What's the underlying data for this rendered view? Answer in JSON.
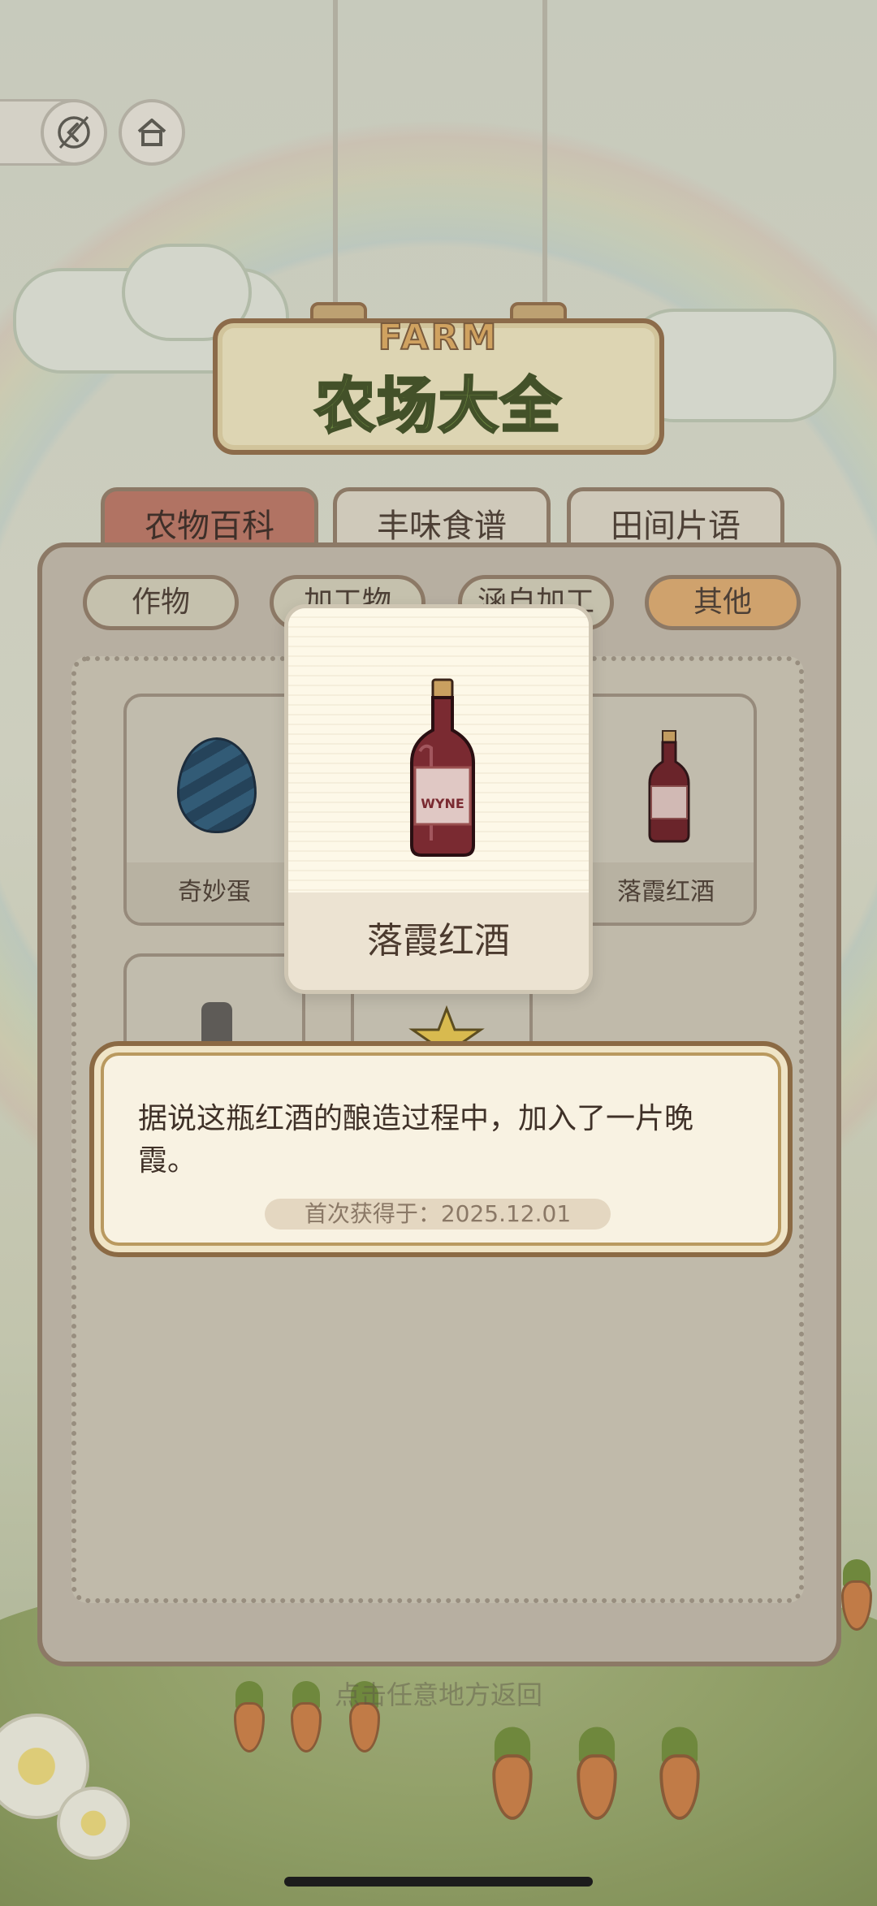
{
  "header": {
    "logo_farm_text": "FARM",
    "logo_title": "农场大全",
    "back_icon": "back-arrow-icon",
    "home_icon": "home-icon"
  },
  "category_tabs": [
    {
      "label": "农物百科",
      "active": true
    },
    {
      "label": "丰味食谱",
      "active": false
    },
    {
      "label": "田间片语",
      "active": false
    }
  ],
  "sub_tabs": [
    {
      "label": "作物",
      "active": false
    },
    {
      "label": "加工物",
      "active": false
    },
    {
      "label": "涵自加工",
      "active": false
    },
    {
      "label": "其他",
      "active": true
    }
  ],
  "grid_items": [
    {
      "name": "奇妙蛋",
      "icon": "egg-icon"
    },
    {
      "name": "落霞红酒",
      "icon": "wine-bottle-icon"
    }
  ],
  "item_popup": {
    "name": "落霞红酒",
    "icon": "wine-bottle-icon",
    "label_text": "WYNE"
  },
  "description_popup": {
    "text": "据说这瓶红酒的酿造过程中，加入了一片晚霞。",
    "first_obtained": "首次获得于：2025.12.01"
  },
  "hint": "点击任意地方返回",
  "colors": {
    "active_tab": "#b77363",
    "active_subtab": "#d7a66e",
    "popup_border": "#8b6a44"
  }
}
